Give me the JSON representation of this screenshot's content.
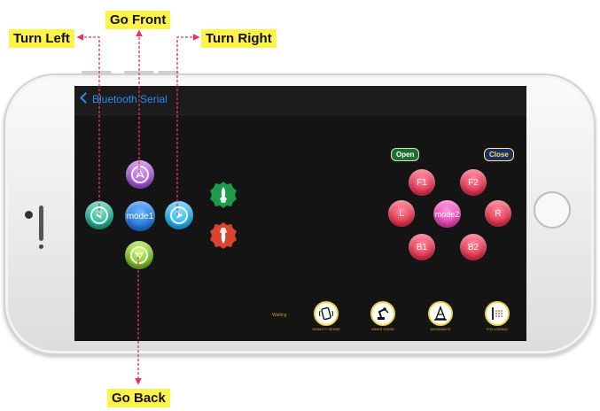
{
  "callouts": {
    "go_front": "Go Front",
    "turn_left": "Turn Left",
    "turn_right": "Turn Right",
    "go_back": "Go Back"
  },
  "navbar": {
    "back_label": "Bluetooth Serial"
  },
  "dpad": {
    "center_label": "mode1"
  },
  "gripper": {
    "open_label": "Open",
    "close_label": "Close"
  },
  "arm_pad": {
    "f1": "F1",
    "f2": "F2",
    "l": "L",
    "center": "mode2",
    "r": "R",
    "b1": "B1",
    "b2": "B2"
  },
  "bottom": {
    "small_text": "Waiting",
    "features": [
      {
        "label": "GRAVITY SENSE"
      },
      {
        "label": "ARM'S GUIDE"
      },
      {
        "label": "AVOIDANCE"
      },
      {
        "label": "FOLLOWING"
      }
    ]
  },
  "colors": {
    "callout_bg": "#fff34a",
    "arrow": "#e8325a",
    "nav_accent": "#2b8cf0"
  }
}
